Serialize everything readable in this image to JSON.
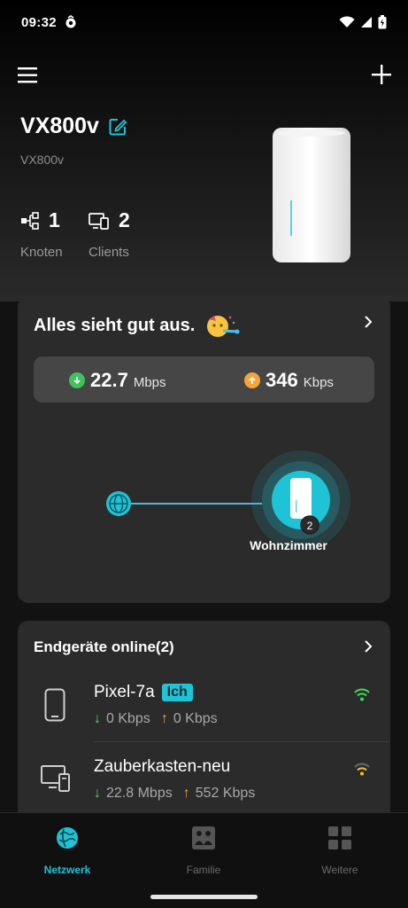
{
  "status_bar": {
    "time": "09:32"
  },
  "device": {
    "name": "VX800v",
    "model": "VX800v"
  },
  "stats": {
    "nodes": {
      "value": "1",
      "label": "Knoten"
    },
    "clients": {
      "value": "2",
      "label": "Clients"
    }
  },
  "status_card": {
    "title": "Alles sieht gut aus.",
    "download": {
      "value": "22.7",
      "unit": "Mbps"
    },
    "upload": {
      "value": "346",
      "unit": "Kbps"
    },
    "node": {
      "name": "Wohnzimmer",
      "client_count": "2"
    }
  },
  "clients_card": {
    "title": "Endgeräte online(2)",
    "items": [
      {
        "name": "Pixel-7a",
        "badge": "Ich",
        "down": "0 Kbps",
        "up": "0 Kbps",
        "signal_color": "#3ddc58"
      },
      {
        "name": "Zauberkasten-neu",
        "badge": "",
        "down": "22.8 Mbps",
        "up": "552 Kbps",
        "signal_color": "#f2c12e"
      }
    ]
  },
  "nav": {
    "network": "Netzwerk",
    "family": "Familie",
    "more": "Weitere"
  },
  "colors": {
    "accent": "#1fc3d6",
    "download": "#5bd06a",
    "upload": "#f4a53a"
  }
}
